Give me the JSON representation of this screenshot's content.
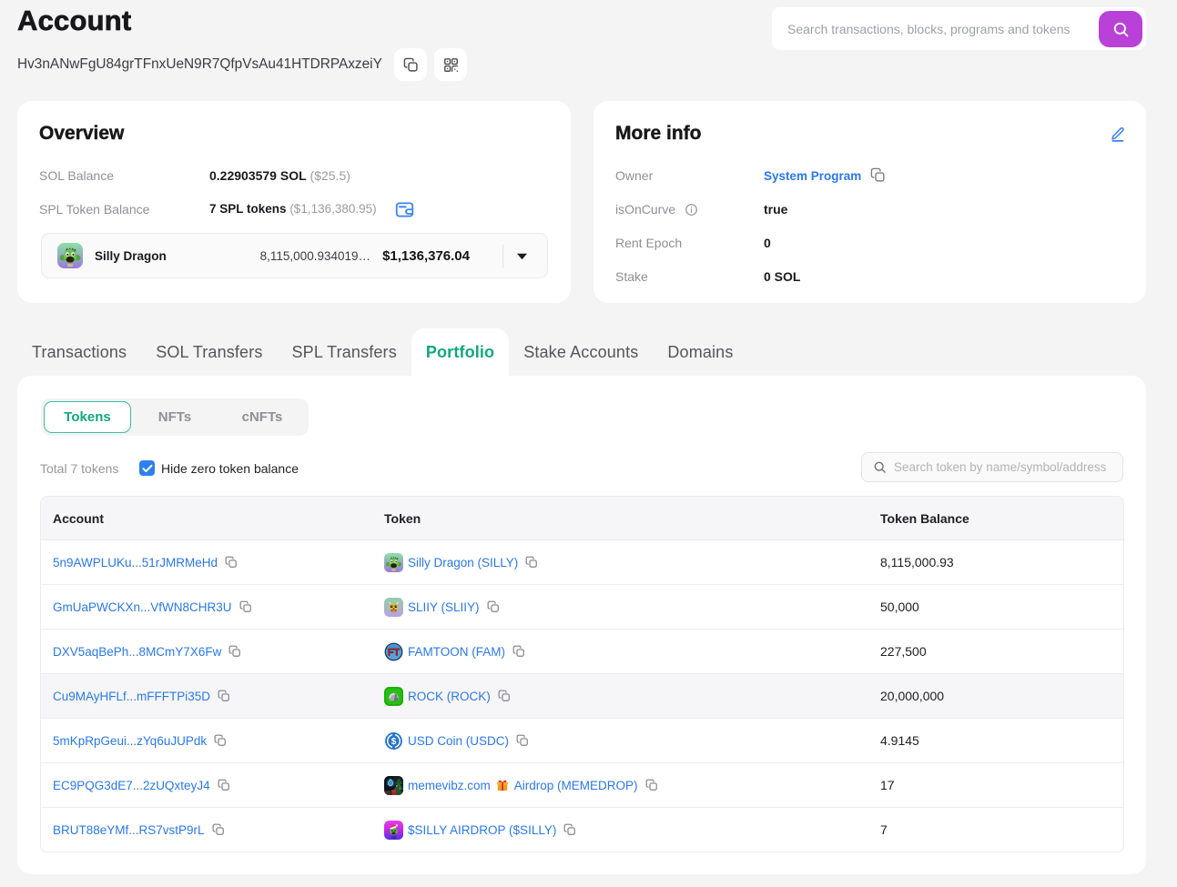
{
  "page": {
    "title": "Account",
    "address": "Hv3nANwFgU84grTFnxUeN9R7QfpVsAu41HTDRPAxzeiY"
  },
  "topbar": {
    "search_placeholder": "Search transactions, blocks, programs and tokens"
  },
  "overview": {
    "title": "Overview",
    "sol_balance_label": "SOL Balance",
    "sol_balance_value": "0.22903579 SOL",
    "sol_balance_usd": "($25.5)",
    "spl_label": "SPL Token Balance",
    "spl_value": "7 SPL tokens",
    "spl_usd": "($1,136,380.95)",
    "token_selector": {
      "name": "Silly Dragon",
      "amount": "8,115,000.934019…",
      "usd": "$1,136,376.04",
      "icon": "silly"
    }
  },
  "more_info": {
    "title": "More info",
    "rows": [
      {
        "label": "Owner",
        "value": "System Program",
        "link": true,
        "copy": true
      },
      {
        "label": "isOnCurve",
        "info": true,
        "value": "true"
      },
      {
        "label": "Rent Epoch",
        "value": "0"
      },
      {
        "label": "Stake",
        "value": "0 SOL"
      }
    ]
  },
  "tabs": {
    "items": [
      "Transactions",
      "SOL Transfers",
      "SPL Transfers",
      "Portfolio",
      "Stake Accounts",
      "Domains"
    ],
    "active": "Portfolio"
  },
  "portfolio": {
    "subtabs": [
      "Tokens",
      "NFTs",
      "cNFTs"
    ],
    "active_subtab": "Tokens",
    "total_label": "Total 7 tokens",
    "hide_zero_label": "Hide zero token balance",
    "hide_zero_checked": true,
    "search_placeholder": "Search token by name/symbol/address",
    "table": {
      "headers": [
        "Account",
        "Token",
        "Token Balance"
      ],
      "rows": [
        {
          "account": "5n9AWPLUKu...51rJMRMeHd",
          "icon": "silly",
          "token": "Silly Dragon (SILLY)",
          "balance": "8,115,000.93"
        },
        {
          "account": "GmUaPWCKXn...VfWN8CHR3U",
          "icon": "sliiy",
          "token": "SLIIY (SLIIY)",
          "balance": "50,000"
        },
        {
          "account": "DXV5aqBePh...8MCmY7X6Fw",
          "icon": "famtoon",
          "token": "FAMTOON (FAM)",
          "balance": "227,500"
        },
        {
          "account": "Cu9MAyHFLf...mFFFTPi35D",
          "icon": "rock",
          "token": "ROCK (ROCK)",
          "balance": "20,000,000",
          "zebra": true
        },
        {
          "account": "5mKpRpGeui...zYq6uJUPdk",
          "icon": "usdc",
          "token": "USD Coin (USDC)",
          "balance": "4.9145"
        },
        {
          "account": "EC9PQG3dE7...2zUQxteyJ4",
          "icon": "memevibz",
          "token_pre": "memevibz.com",
          "gift": true,
          "token_post": "Airdrop (MEMEDROP)",
          "balance": "17"
        },
        {
          "account": "BRUT88eYMf...RS7vstP9rL",
          "icon": "sillyair",
          "token": "$SILLY AIRDROP ($SILLY)",
          "balance": "7"
        }
      ]
    }
  }
}
